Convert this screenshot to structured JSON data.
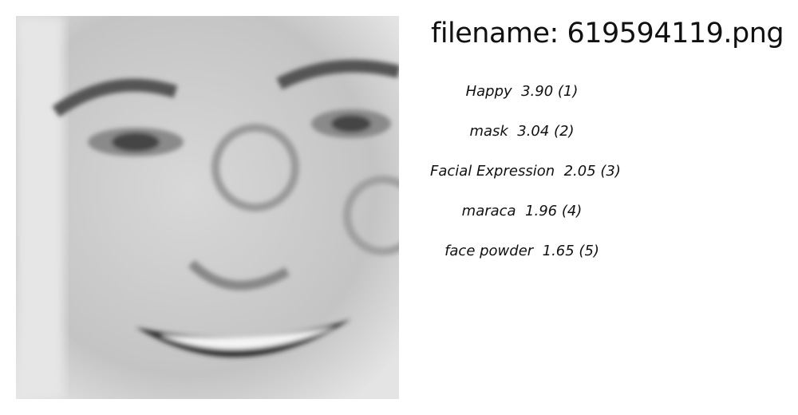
{
  "title": "filename: 619594119.png",
  "predictions": [
    {
      "text": "Happy  3.90 (1)"
    },
    {
      "text": "mask  3.04 (2)"
    },
    {
      "text": "Facial Expression  2.05 (3)"
    },
    {
      "text": "maraca  1.96 (4)"
    },
    {
      "text": "face powder  1.65 (5)"
    }
  ]
}
